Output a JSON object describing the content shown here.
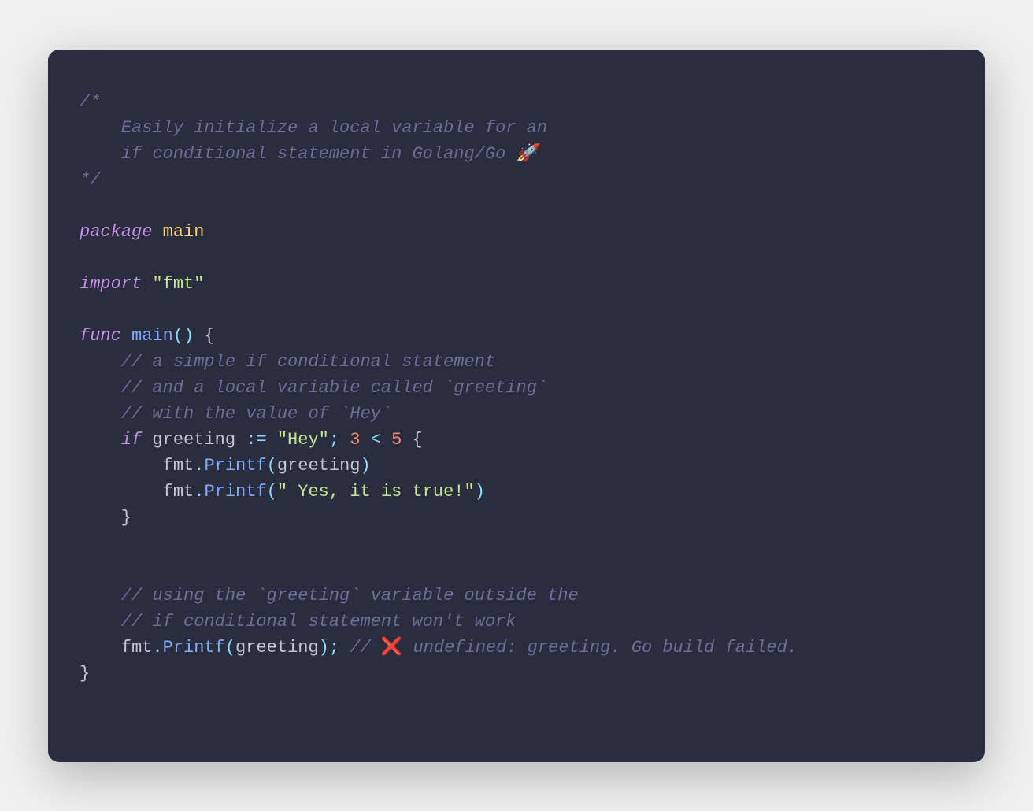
{
  "colors": {
    "background": "#292d3e",
    "comment": "#697098",
    "keyword": "#c792ea",
    "identifier": "#bfc7d5",
    "typeName": "#ffcb6b",
    "funcCall": "#82aaff",
    "operator": "#89ddff",
    "string": "#c3e88d",
    "number": "#f78c6c"
  },
  "blockComment": {
    "open": "/*",
    "line1": "    Easily initialize a local variable for an",
    "line2": "    if conditional statement in Golang/Go 🚀",
    "close": "*/"
  },
  "pkg": {
    "kw": "package",
    "name": "main"
  },
  "imp": {
    "kw": "import",
    "path": "\"fmt\""
  },
  "fn": {
    "kw": "func",
    "name": "main",
    "parens": "()",
    "open": " {"
  },
  "c1": "    // a simple if conditional statement",
  "c2": "    // and a local variable called `greeting`",
  "c3": "    // with the value of `Hey`",
  "ifline": {
    "indent": "    ",
    "kw": "if",
    "sp1": " ",
    "var": "greeting",
    "sp2": " ",
    "assign": ":=",
    "sp3": " ",
    "str": "\"Hey\"",
    "semi": ";",
    "sp4": " ",
    "n1": "3",
    "sp5": " ",
    "lt": "<",
    "sp6": " ",
    "n2": "5",
    "sp7": " ",
    "open": "{"
  },
  "call1": {
    "indent": "        ",
    "obj": "fmt",
    "dot": ".",
    "fn": "Printf",
    "lp": "(",
    "arg": "greeting",
    "rp": ")"
  },
  "call2": {
    "indent": "        ",
    "obj": "fmt",
    "dot": ".",
    "fn": "Printf",
    "lp": "(",
    "arg": "\" Yes, it is true!\"",
    "rp": ")"
  },
  "closeIf": "    }",
  "c4": "    // using the `greeting` variable outside the",
  "c5": "    // if conditional statement won't work",
  "call3": {
    "indent": "    ",
    "obj": "fmt",
    "dot": ".",
    "fn": "Printf",
    "lp": "(",
    "arg": "greeting",
    "rp": ")",
    "semi": ";",
    "sp": " ",
    "commentPrefix": "// ",
    "emoji": "❌",
    "commentRest": " undefined: greeting. Go build failed."
  },
  "closeFn": "}"
}
